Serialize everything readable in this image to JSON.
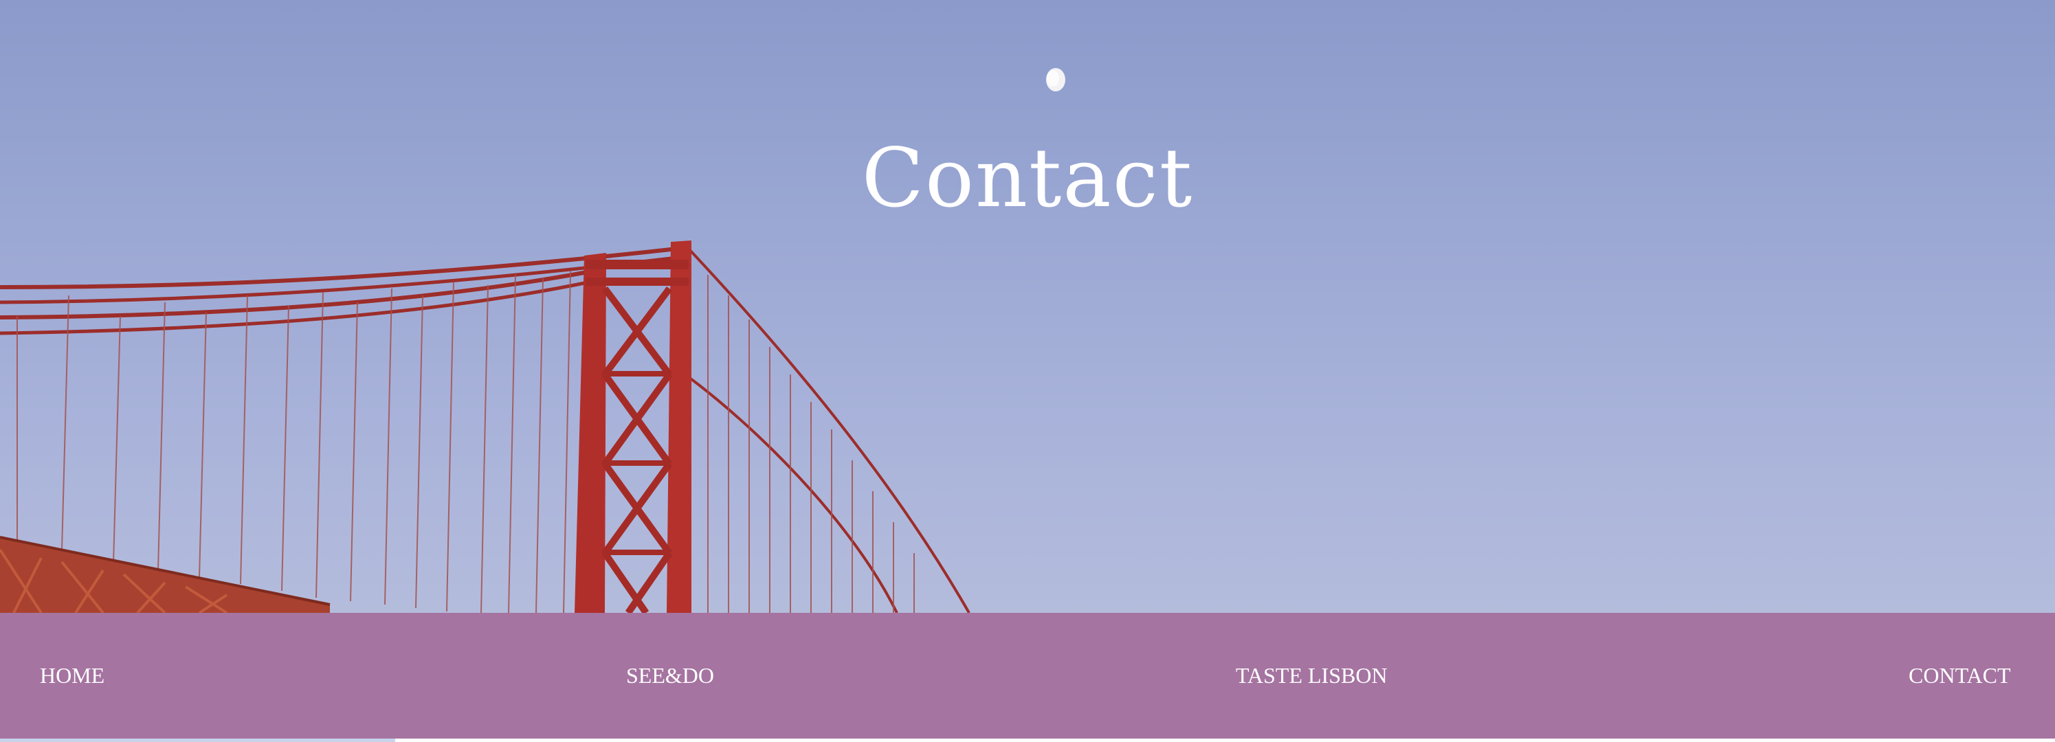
{
  "hero": {
    "title": "Contact"
  },
  "nav": {
    "items": [
      {
        "label": "HOME"
      },
      {
        "label": "SEE&DO"
      },
      {
        "label": "TASTE LISBON"
      },
      {
        "label": "CONTACT"
      }
    ]
  },
  "colors": {
    "nav_background": "#a574a1",
    "sky_top": "#8b9acb",
    "sky_bottom": "#b4bcdc",
    "bridge": "#b5302c",
    "title_text": "#ffffff"
  }
}
